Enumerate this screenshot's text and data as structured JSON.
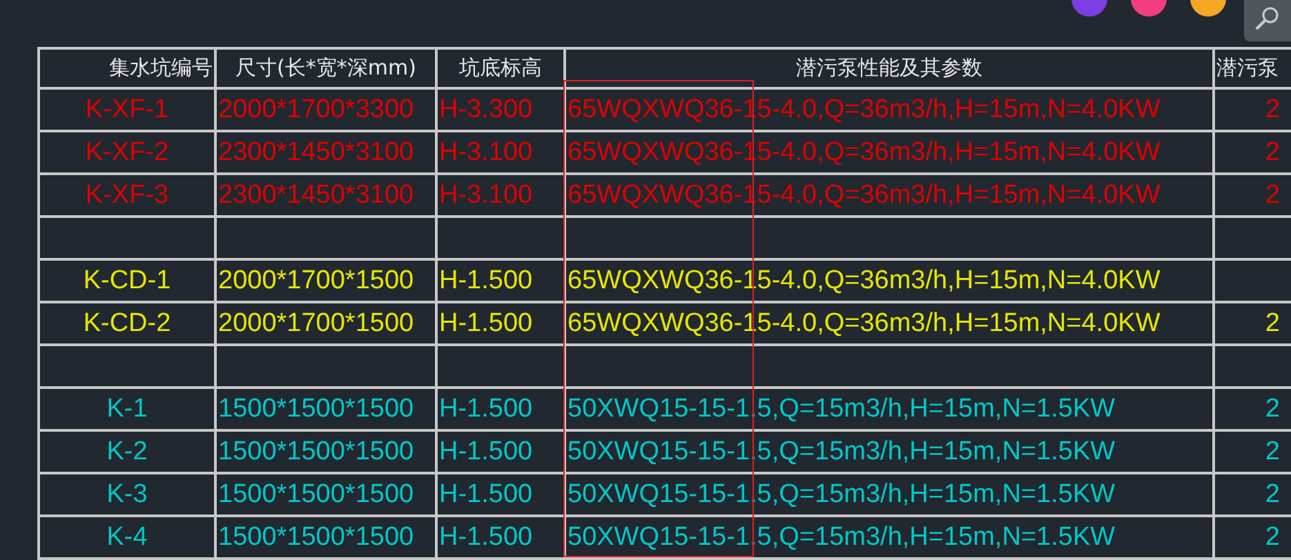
{
  "columns": [
    "集水坑编号",
    "尺寸(长*宽*深mm)",
    "坑底标高",
    "潜污泵性能及其参数",
    "潜污泵"
  ],
  "rows": [
    {
      "kind": "pit",
      "color": "#e00000",
      "cells": [
        "K-XF-1",
        "2000*1700*3300",
        "H-3.300",
        "65WQXWQ36-15-4.0,Q=36m3/h,H=15m,N=4.0KW",
        "2"
      ]
    },
    {
      "kind": "pit",
      "color": "#e00000",
      "cells": [
        "K-XF-2",
        "2300*1450*3100",
        "H-3.100",
        "65WQXWQ36-15-4.0,Q=36m3/h,H=15m,N=4.0KW",
        "2"
      ]
    },
    {
      "kind": "pit",
      "color": "#e00000",
      "cells": [
        "K-XF-3",
        "2300*1450*3100",
        "H-3.100",
        "65WQXWQ36-15-4.0,Q=36m3/h,H=15m,N=4.0KW",
        "2"
      ]
    },
    {
      "kind": "blank"
    },
    {
      "kind": "pit",
      "color": "#e6e600",
      "cells": [
        "K-CD-1",
        "2000*1700*1500",
        "H-1.500",
        "65WQXWQ36-15-4.0,Q=36m3/h,H=15m,N=4.0KW",
        ""
      ]
    },
    {
      "kind": "pit",
      "color": "#e6e600",
      "cells": [
        "K-CD-2",
        "2000*1700*1500",
        "H-1.500",
        "65WQXWQ36-15-4.0,Q=36m3/h,H=15m,N=4.0KW",
        "2"
      ]
    },
    {
      "kind": "blank"
    },
    {
      "kind": "pit",
      "color": "#00c8c8",
      "cells": [
        "K-1",
        "1500*1500*1500",
        "H-1.500",
        "50XWQ15-15-1.5,Q=15m3/h,H=15m,N=1.5KW",
        "2"
      ]
    },
    {
      "kind": "pit",
      "color": "#00c8c8",
      "cells": [
        "K-2",
        "1500*1500*1500",
        "H-1.500",
        "50XWQ15-15-1.5,Q=15m3/h,H=15m,N=1.5KW",
        "2"
      ]
    },
    {
      "kind": "pit",
      "color": "#00c8c8",
      "cells": [
        "K-3",
        "1500*1500*1500",
        "H-1.500",
        "50XWQ15-15-1.5,Q=15m3/h,H=15m,N=1.5KW",
        "2"
      ]
    },
    {
      "kind": "pit",
      "color": "#00c8c8",
      "cells": [
        "K-4",
        "1500*1500*1500",
        "H-1.500",
        "50XWQ15-15-1.5,Q=15m3/h,H=15m,N=1.5KW",
        "2"
      ]
    }
  ]
}
